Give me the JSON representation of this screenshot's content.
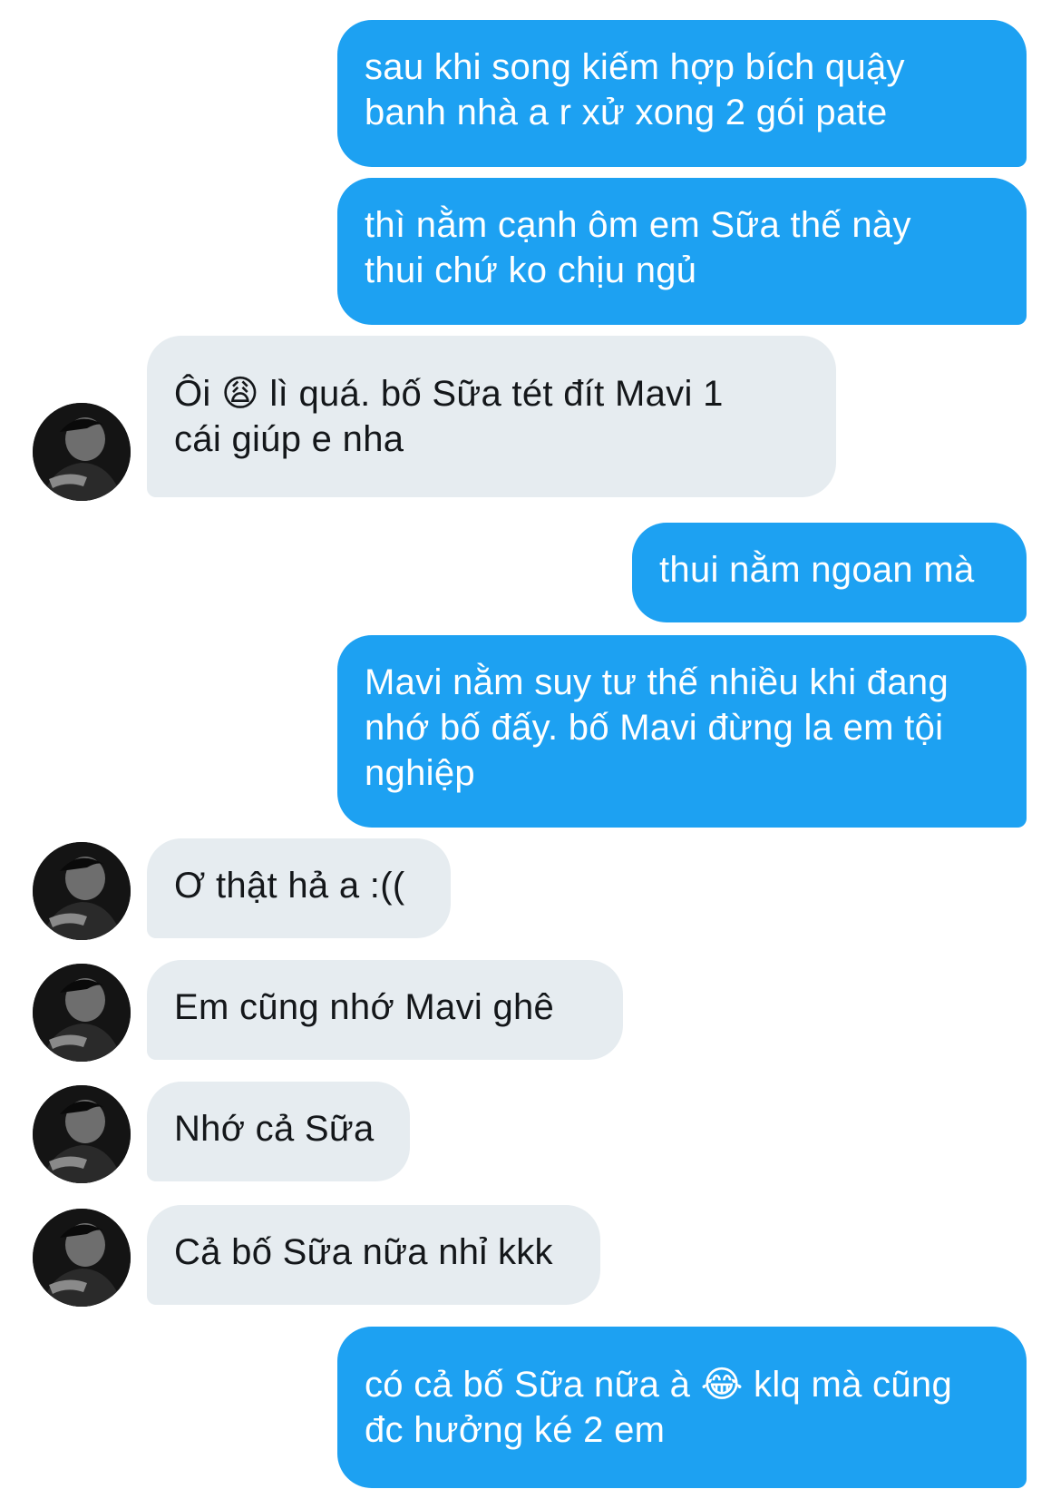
{
  "conversation": {
    "messages": [
      {
        "sender": "me",
        "text": "sau khi song kiếm hợp bích quậy\nbanh nhà a r xử xong 2 gói pate"
      },
      {
        "sender": "me",
        "text": "thì nằm cạnh ôm em Sữa thế này\nthui chứ ko chịu ngủ"
      },
      {
        "sender": "them",
        "text": "Ôi 😩 lì quá. bố Sữa tét đít Mavi 1\ncái giúp e nha"
      },
      {
        "sender": "me",
        "text": "thui nằm ngoan mà"
      },
      {
        "sender": "me",
        "text": "Mavi nằm suy tư thế nhiều khi đang\nnhớ bố đấy. bố Mavi đừng la em tội\nnghiệp"
      },
      {
        "sender": "them",
        "text": "Ơ thật hả a :(("
      },
      {
        "sender": "them",
        "text": "Em cũng nhớ Mavi ghê"
      },
      {
        "sender": "them",
        "text": "Nhớ cả Sữa"
      },
      {
        "sender": "them",
        "text": "Cả bố Sữa nữa nhỉ kkk"
      },
      {
        "sender": "me",
        "text": "có cả bố Sữa nữa à 😂 klq mà cũng\nđc hưởng ké 2 em"
      }
    ]
  },
  "colors": {
    "outgoing_bubble": "#1da1f2",
    "incoming_bubble": "#e6ecf0",
    "outgoing_text": "#ffffff",
    "incoming_text": "#14171a"
  },
  "icons": {
    "avatar": "contact-avatar-photo"
  }
}
